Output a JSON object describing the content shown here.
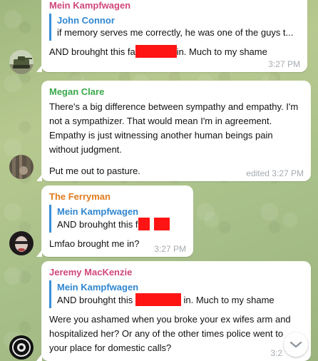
{
  "messages": [
    {
      "sender": "Mein Kampfwagen",
      "sender_color": "#d0467b",
      "reply_name": "John Connor",
      "reply_text": "if memory serves me correctly, he was one of the guys t...",
      "text_before": "AND brouhght this fa",
      "text_after": "in. Much to my shame",
      "time": "3:27 PM",
      "avatar": "tank-photo-avatar"
    },
    {
      "sender": "Megan Clare",
      "sender_color": "#3aa84a",
      "paragraph1": "There's a big difference between sympathy and empathy. I'm not a sympathizer.  That would mean I'm in agreement. Empathy is just witnessing another human beings pain without judgment.",
      "paragraph2": "Put me out to pasture.",
      "time": "edited 3:27 PM",
      "avatar": "forest-photo-avatar"
    },
    {
      "sender": "The Ferryman",
      "sender_color": "#e07b1f",
      "reply_name": "Mein Kampfwagen",
      "reply_text_before": "AND brouhght this f",
      "text": "Lmfao brought me in?",
      "time": "3:27 PM",
      "avatar": "portrait-photo-avatar"
    },
    {
      "sender": "Jeremy MacKenzie",
      "sender_color": "#d0467b",
      "reply_name": "Mein Kampfwagen",
      "reply_text_before": "AND brouhght this",
      "reply_text_after": "in. Much to my shame",
      "text": "Were you ashamed when you broke your ex wifes arm and hospitalized her? Or any of the other times police went to your place for domestic calls?",
      "time": "3:2",
      "avatar": "emblem-avatar"
    }
  ],
  "colors": {
    "redaction": "#ff1414",
    "reply_accent": "#3a8fd6",
    "bubble": "#ffffff"
  },
  "scroll_button_icon": "chevron-down-icon"
}
